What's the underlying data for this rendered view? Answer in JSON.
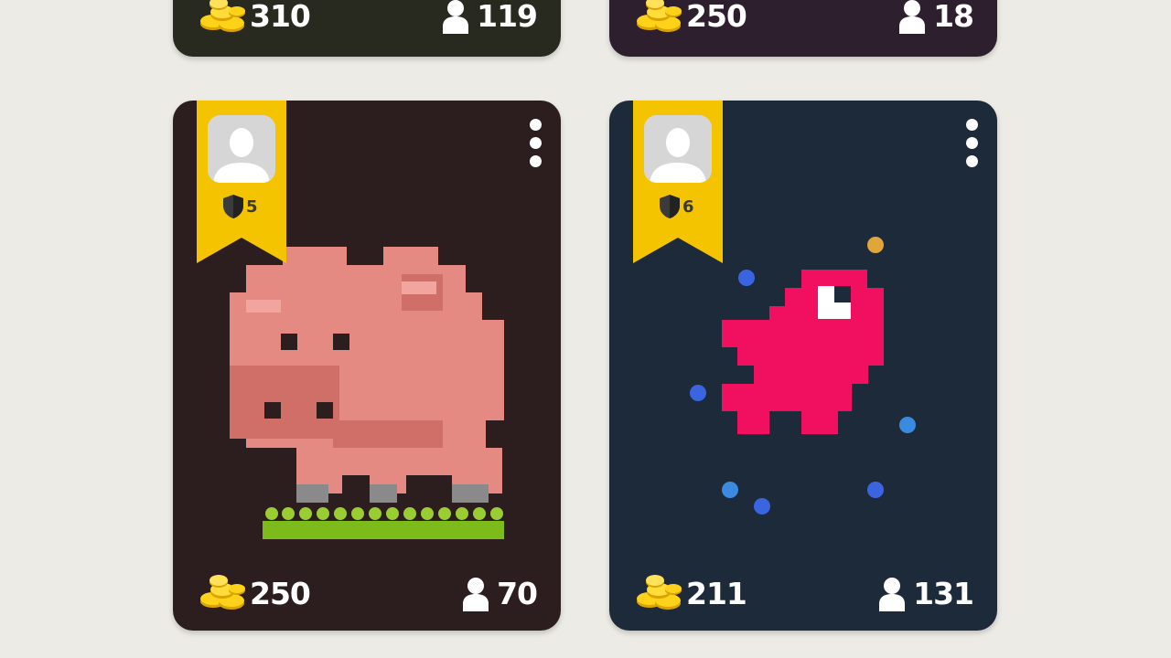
{
  "cards": [
    {
      "id": "top-left",
      "bg": "#292a1f",
      "coins": "310",
      "players": "119"
    },
    {
      "id": "top-right",
      "bg": "#2e1f2e",
      "coins": "250",
      "players": "18"
    },
    {
      "id": "pig-card",
      "bg": "#2c1e1e",
      "coins": "250",
      "players": "70",
      "level": "5"
    },
    {
      "id": "bird-card",
      "bg": "#1c2a3a",
      "coins": "211",
      "players": "131",
      "level": "6"
    }
  ],
  "colors": {
    "page_bg": "#ecebe5",
    "ribbon": "#f5c400",
    "coin": "#f5c400",
    "pig": "#e58a82",
    "bird": "#f0105f",
    "grass": "#7dbb1a"
  },
  "icons": [
    "coins-icon",
    "person-icon",
    "shield-icon",
    "avatar-placeholder-icon",
    "more-menu-icon"
  ]
}
